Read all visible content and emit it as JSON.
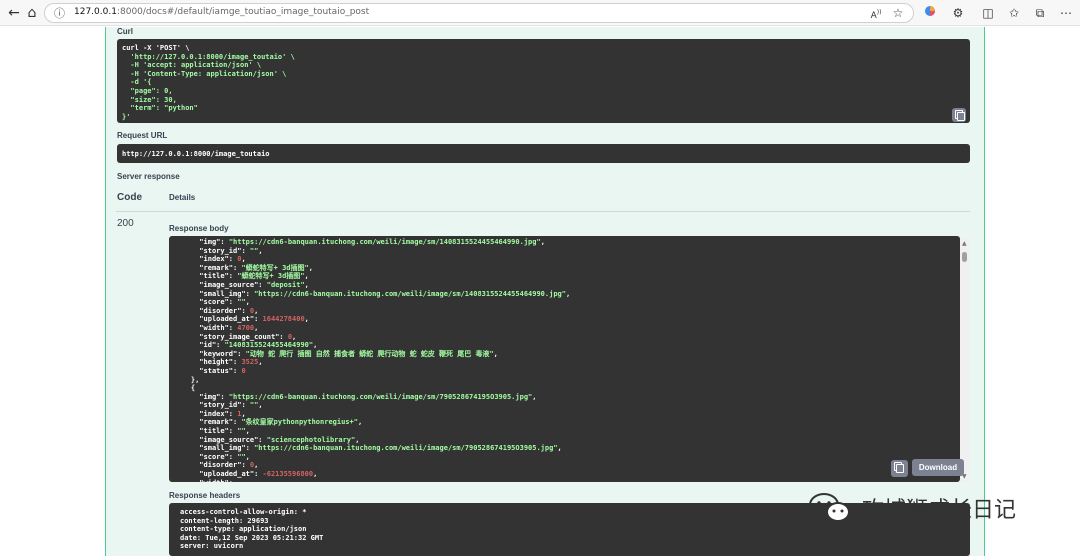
{
  "browser": {
    "url_host": "127.0.0.1",
    "url_path": ":8000/docs#/default/iamge_toutiao_image_toutaio_post",
    "icons": [
      "back-arrow-icon",
      "home-icon",
      "info-icon",
      "read-aloud-icon",
      "favorite-star-icon",
      "copilot-icon",
      "extensions-icon",
      "split-screen-icon",
      "favorites-icon",
      "collections-icon",
      "more-icon"
    ]
  },
  "sections": {
    "curl_label": "Curl",
    "request_url_label": "Request URL",
    "server_response_label": "Server response",
    "code_header": "Code",
    "details_header": "Details",
    "response_body_label": "Response body",
    "response_headers_label": "Response headers"
  },
  "curl_lines": [
    [
      "curl -X 'POST' \\",
      "w"
    ],
    [
      "  'http://127.0.0.1:8000/image_toutaio' \\",
      "g"
    ],
    [
      "  -H 'accept: application/json' \\",
      "g"
    ],
    [
      "  -H 'Content-Type: application/json' \\",
      "g"
    ],
    [
      "  -d '{",
      "g"
    ],
    [
      "  \"page\": 0,",
      "g"
    ],
    [
      "  \"size\": 30,",
      "g"
    ],
    [
      "  \"term\": \"python\"",
      "g"
    ],
    [
      "}'",
      "g"
    ]
  ],
  "request_url": "http://127.0.0.1:8000/image_toutaio",
  "response": {
    "status_code": "200",
    "download_label": "Download",
    "body_lines": [
      [
        [
          "      ",
          "k"
        ],
        [
          "\"img\": ",
          "k"
        ],
        [
          "\"https://cdn6-banquan.ituchong.com/weili/image/sm/1408315524455464990.jpg\"",
          "s"
        ],
        [
          ",",
          "k"
        ]
      ],
      [
        [
          "      ",
          "k"
        ],
        [
          "\"story_id\": ",
          "k"
        ],
        [
          "\"\"",
          "s"
        ],
        [
          ",",
          "k"
        ]
      ],
      [
        [
          "      ",
          "k"
        ],
        [
          "\"index\": ",
          "k"
        ],
        [
          "0",
          "n"
        ],
        [
          ",",
          "k"
        ]
      ],
      [
        [
          "      ",
          "k"
        ],
        [
          "\"remark\": ",
          "k"
        ],
        [
          "\"蟒蛇特写+ 3d插图\"",
          "s"
        ],
        [
          ",",
          "k"
        ]
      ],
      [
        [
          "      ",
          "k"
        ],
        [
          "\"title\": ",
          "k"
        ],
        [
          "\"蟒蛇特写+ 3d插图\"",
          "s"
        ],
        [
          ",",
          "k"
        ]
      ],
      [
        [
          "      ",
          "k"
        ],
        [
          "\"image_source\": ",
          "k"
        ],
        [
          "\"deposit\"",
          "s"
        ],
        [
          ",",
          "k"
        ]
      ],
      [
        [
          "      ",
          "k"
        ],
        [
          "\"small_img\": ",
          "k"
        ],
        [
          "\"https://cdn6-banquan.ituchong.com/weili/image/sm/1408315524455464990.jpg\"",
          "s"
        ],
        [
          ",",
          "k"
        ]
      ],
      [
        [
          "      ",
          "k"
        ],
        [
          "\"score\": ",
          "k"
        ],
        [
          "\"\"",
          "s"
        ],
        [
          ",",
          "k"
        ]
      ],
      [
        [
          "      ",
          "k"
        ],
        [
          "\"disorder\": ",
          "k"
        ],
        [
          "0",
          "n"
        ],
        [
          ",",
          "k"
        ]
      ],
      [
        [
          "      ",
          "k"
        ],
        [
          "\"uploaded_at\": ",
          "k"
        ],
        [
          "1644278400",
          "n"
        ],
        [
          ",",
          "k"
        ]
      ],
      [
        [
          "      ",
          "k"
        ],
        [
          "\"width\": ",
          "k"
        ],
        [
          "4700",
          "n"
        ],
        [
          ",",
          "k"
        ]
      ],
      [
        [
          "      ",
          "k"
        ],
        [
          "\"story_image_count\": ",
          "k"
        ],
        [
          "0",
          "n"
        ],
        [
          ",",
          "k"
        ]
      ],
      [
        [
          "      ",
          "k"
        ],
        [
          "\"id\": ",
          "k"
        ],
        [
          "\"1408315524455464990\"",
          "s"
        ],
        [
          ",",
          "k"
        ]
      ],
      [
        [
          "      ",
          "k"
        ],
        [
          "\"keyword\": ",
          "k"
        ],
        [
          "\"动物 蛇 爬行 插图 自然 捕食者 蟒蛇 爬行动物 蛇 蛇皮 鞭死 尾巴 毒液\"",
          "s"
        ],
        [
          ",",
          "k"
        ]
      ],
      [
        [
          "      ",
          "k"
        ],
        [
          "\"height\": ",
          "k"
        ],
        [
          "3525",
          "n"
        ],
        [
          ",",
          "k"
        ]
      ],
      [
        [
          "      ",
          "k"
        ],
        [
          "\"status\": ",
          "k"
        ],
        [
          "0",
          "n"
        ]
      ],
      [
        [
          "    },",
          "k"
        ]
      ],
      [
        [
          "    {",
          "k"
        ]
      ],
      [
        [
          "      ",
          "k"
        ],
        [
          "\"img\": ",
          "k"
        ],
        [
          "\"https://cdn6-banquan.ituchong.com/weili/image/sm/790528674195O3905.jpg\"",
          "s"
        ],
        [
          ",",
          "k"
        ]
      ],
      [
        [
          "      ",
          "k"
        ],
        [
          "\"story_id\": ",
          "k"
        ],
        [
          "\"\"",
          "s"
        ],
        [
          ",",
          "k"
        ]
      ],
      [
        [
          "      ",
          "k"
        ],
        [
          "\"index\": ",
          "k"
        ],
        [
          "1",
          "n"
        ],
        [
          ",",
          "k"
        ]
      ],
      [
        [
          "      ",
          "k"
        ],
        [
          "\"remark\": ",
          "k"
        ],
        [
          "\"条纹皇家pythonpythonregius+\"",
          "s"
        ],
        [
          ",",
          "k"
        ]
      ],
      [
        [
          "      ",
          "k"
        ],
        [
          "\"title\": ",
          "k"
        ],
        [
          "\"\"",
          "s"
        ],
        [
          ",",
          "k"
        ]
      ],
      [
        [
          "      ",
          "k"
        ],
        [
          "\"image_source\": ",
          "k"
        ],
        [
          "\"sciencephotolibrary\"",
          "s"
        ],
        [
          ",",
          "k"
        ]
      ],
      [
        [
          "      ",
          "k"
        ],
        [
          "\"small_img\": ",
          "k"
        ],
        [
          "\"https://cdn6-banquan.ituchong.com/weili/image/sm/790528674195O3905.jpg\"",
          "s"
        ],
        [
          ",",
          "k"
        ]
      ],
      [
        [
          "      ",
          "k"
        ],
        [
          "\"score\": ",
          "k"
        ],
        [
          "\"\"",
          "s"
        ],
        [
          ",",
          "k"
        ]
      ],
      [
        [
          "      ",
          "k"
        ],
        [
          "\"disorder\": ",
          "k"
        ],
        [
          "0",
          "n"
        ],
        [
          ",",
          "k"
        ]
      ],
      [
        [
          "      ",
          "k"
        ],
        [
          "\"uploaded_at\": ",
          "k"
        ],
        [
          "-62135596800",
          "n"
        ],
        [
          ",",
          "k"
        ]
      ],
      [
        [
          "      ",
          "k"
        ],
        [
          "\"width\": ",
          "k"
        ],
        [
          "",
          "n"
        ]
      ]
    ],
    "header_lines": [
      "access-control-allow-origin: *",
      "content-length: 29693",
      "content-type: application/json",
      "date: Tue,12 Sep 2023 05:21:32 GMT",
      "server: uvicorn"
    ]
  },
  "watermark": {
    "text": "攻城狮成长日记"
  },
  "colors": {
    "panel_bg": "#eaf6f1",
    "panel_border": "#49cc90",
    "code_bg": "#333333",
    "string": "#a2fca2",
    "number": "#d36363",
    "button": "#7d8293"
  }
}
